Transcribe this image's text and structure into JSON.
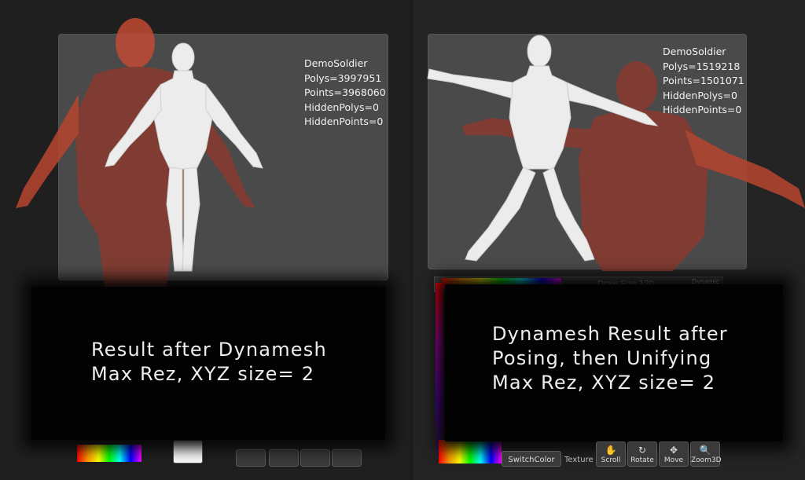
{
  "left": {
    "stats": {
      "name": "DemoSoldier",
      "polys": "Polys=3997951",
      "points": "Points=3968060",
      "hidden_polys": "HiddenPolys=0",
      "hidden_points": "HiddenPoints=0"
    },
    "caption": {
      "line1": "Result after Dynamesh",
      "line2": "Max Rez, XYZ size= 2"
    }
  },
  "right": {
    "stats": {
      "name": "DemoSoldier",
      "polys": "Polys=1519218",
      "points": "Points=1501071",
      "hidden_polys": "HiddenPolys=0",
      "hidden_points": "HiddenPoints=0"
    },
    "caption": {
      "line1": "Dynamesh Result after",
      "line2": "Posing, then Unifying",
      "line3": "Max Rez, XYZ size= 2"
    },
    "toolbar": {
      "draw_size": "Draw Size 120",
      "dynamic": "Dynamic",
      "switch_color": "SwitchColor",
      "texture": "Texture",
      "scroll": "Scroll",
      "rotate": "Rotate",
      "move": "Move",
      "zoom3d": "Zoom3D"
    }
  },
  "colors": {
    "viewport": "#4a4a4a",
    "background_figure": "#8a3a2e",
    "foreground_figure": "#eeeeee",
    "caption_bg": "#020202"
  },
  "icons": [
    "scroll-icon",
    "rotate-icon",
    "move-icon",
    "zoom3d-icon"
  ]
}
